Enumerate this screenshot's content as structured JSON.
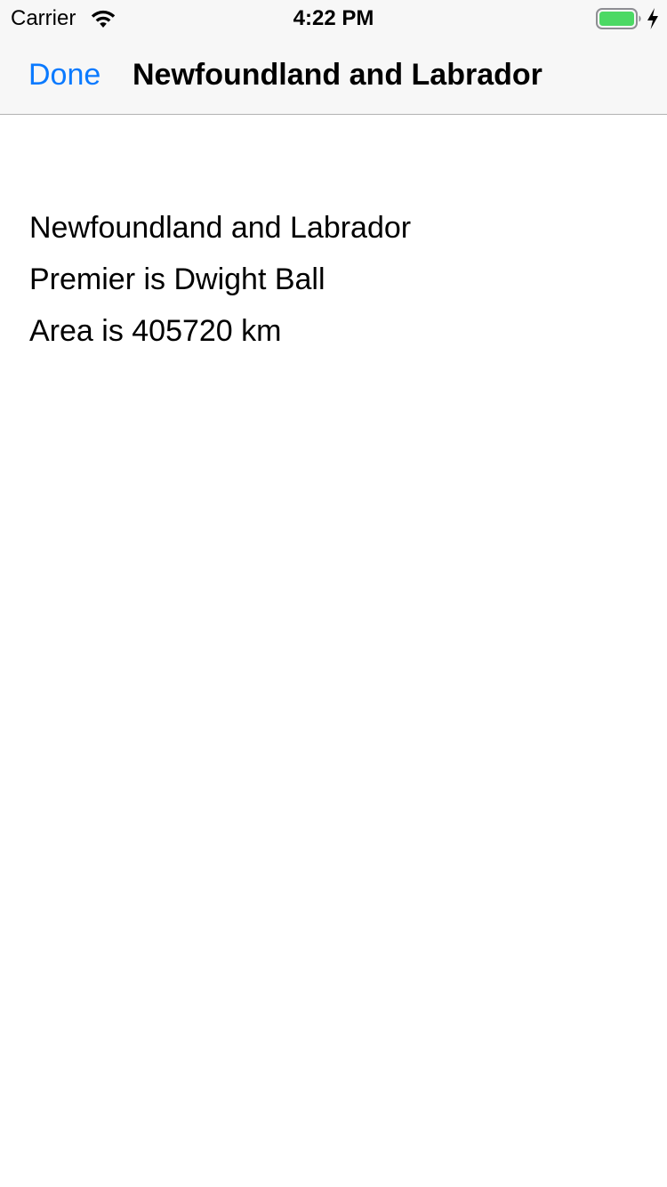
{
  "status_bar": {
    "carrier": "Carrier",
    "time": "4:22 PM",
    "icons": [
      "wifi-icon",
      "battery-icon",
      "charging-icon"
    ],
    "battery_color": "#4cd964"
  },
  "nav": {
    "done_label": "Done",
    "title": "Newfoundland and Labrador",
    "accent_color": "#0a7aff"
  },
  "content": {
    "name": "Newfoundland and Labrador",
    "premier": "Premier is Dwight Ball",
    "area": "Area is 405720 km"
  }
}
